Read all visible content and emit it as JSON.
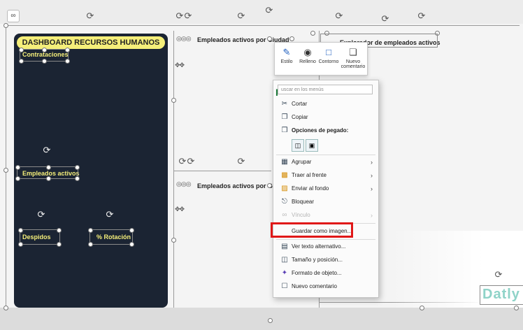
{
  "dashboard": {
    "title": "DASHBOARD RECURSOS HUMANOS",
    "labels": {
      "contrataciones": "Contrataciones",
      "empleados_activos": "Empleados activos",
      "despidos": "Despidos",
      "rotacion": "% Rotación"
    }
  },
  "charts": {
    "ciudad_title": "Empleados activos por Ciudad",
    "explorador_title": "Explorador de empleados activos",
    "genero_title": "Empleados activos por Gen"
  },
  "mini_toolbar": {
    "estilo": "Estilo",
    "relleno": "Relleno",
    "contorno": "Contorno",
    "nuevo_comentario": "Nuevo comentario"
  },
  "context_menu": {
    "search_placeholder": "uscar en los menús",
    "items": {
      "cortar": "Cortar",
      "copiar": "Copiar",
      "opciones_pegado": "Opciones de pegado:",
      "agrupar": "Agrupar",
      "traer_frente": "Traer al frente",
      "enviar_fondo": "Enviar al fondo",
      "bloquear": "Bloquear",
      "vinculo": "Vínculo",
      "guardar_imagen": "Guardar como imagen...",
      "ver_texto_alt": "Ver texto alternativo...",
      "tamano_posicion": "Tamaño y posición...",
      "formato_objeto": "Formato de objeto...",
      "nuevo_comentario": "Nuevo comentario"
    }
  },
  "logo_text": "Datly",
  "colors": {
    "panel_bg": "#1b2433",
    "accent_yellow": "#f5ef7a",
    "highlight_red": "#e01818"
  }
}
